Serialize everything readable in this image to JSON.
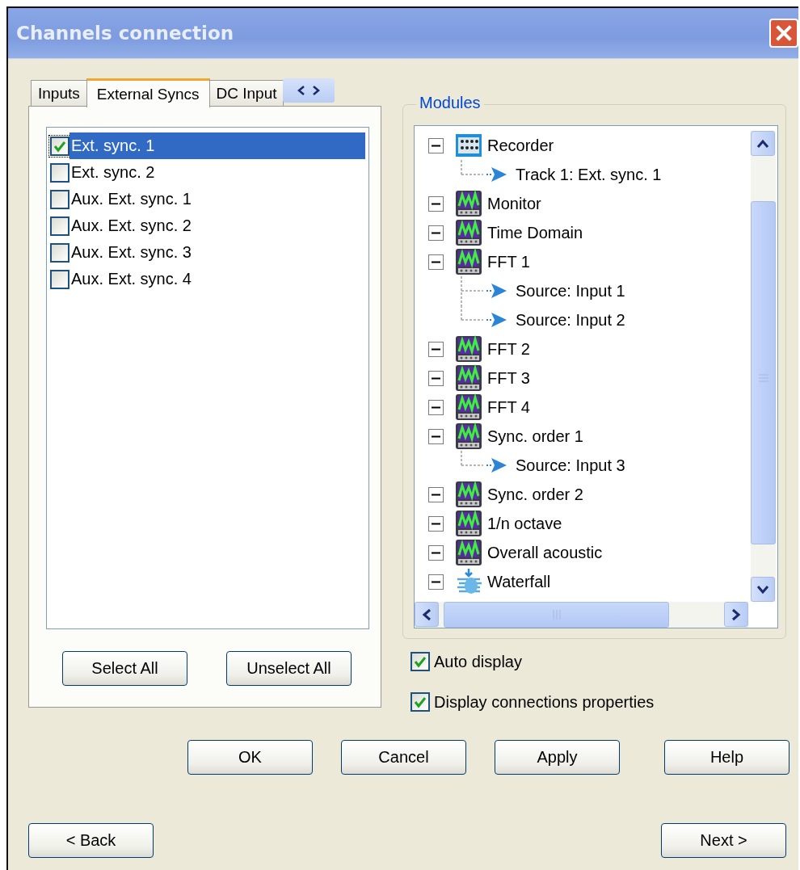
{
  "window": {
    "title": "Channels connection"
  },
  "tabs": [
    {
      "label": "Inputs",
      "selected": false
    },
    {
      "label": "External Syncs",
      "selected": true
    },
    {
      "label": "DC Input",
      "selected": false
    }
  ],
  "sync_list": [
    {
      "label": "Ext. sync. 1",
      "checked": true,
      "selected": true
    },
    {
      "label": "Ext. sync. 2",
      "checked": false,
      "selected": false
    },
    {
      "label": "Aux. Ext. sync. 1",
      "checked": false,
      "selected": false
    },
    {
      "label": "Aux. Ext. sync. 2",
      "checked": false,
      "selected": false
    },
    {
      "label": "Aux. Ext. sync. 3",
      "checked": false,
      "selected": false
    },
    {
      "label": "Aux. Ext. sync. 4",
      "checked": false,
      "selected": false
    }
  ],
  "list_buttons": [
    "Select All",
    "Unselect All"
  ],
  "modules": {
    "title": "Modules",
    "items": [
      {
        "label": "Recorder",
        "kind": "recorder",
        "expanded": true,
        "children": [
          {
            "label": "Track 1: Ext. sync. 1"
          }
        ]
      },
      {
        "label": "Monitor",
        "kind": "analyzer",
        "expanded": true
      },
      {
        "label": "Time Domain",
        "kind": "analyzer",
        "expanded": true
      },
      {
        "label": "FFT 1",
        "kind": "analyzer",
        "expanded": true,
        "children": [
          {
            "label": "Source: Input 1"
          },
          {
            "label": "Source: Input 2"
          }
        ]
      },
      {
        "label": "FFT 2",
        "kind": "analyzer",
        "expanded": true
      },
      {
        "label": "FFT 3",
        "kind": "analyzer",
        "expanded": true
      },
      {
        "label": "FFT 4",
        "kind": "analyzer",
        "expanded": true
      },
      {
        "label": "Sync. order 1",
        "kind": "analyzer",
        "expanded": true,
        "children": [
          {
            "label": "Source: Input 3"
          }
        ]
      },
      {
        "label": "Sync. order 2",
        "kind": "analyzer",
        "expanded": true
      },
      {
        "label": "1/n octave",
        "kind": "analyzer",
        "expanded": true
      },
      {
        "label": "Overall acoustic",
        "kind": "analyzer",
        "expanded": true
      },
      {
        "label": "Waterfall",
        "kind": "waterfall",
        "expanded": true
      }
    ]
  },
  "options": [
    {
      "label": "Auto display",
      "checked": true
    },
    {
      "label": "Display connections properties",
      "checked": true
    }
  ],
  "buttons": [
    "OK",
    "Cancel",
    "Apply",
    "Help"
  ],
  "nav_buttons": [
    "< Back",
    "Next >"
  ]
}
